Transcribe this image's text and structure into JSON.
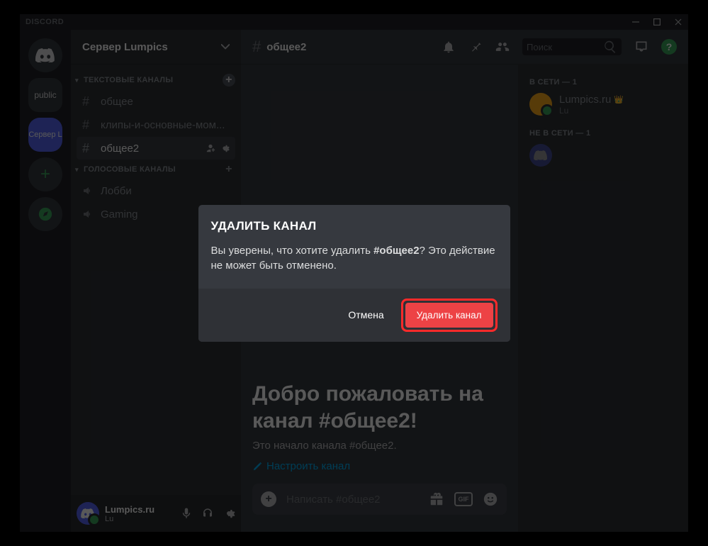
{
  "titlebar": {
    "logo": "DISCORD"
  },
  "server_header": {
    "name": "Сервер Lumpics"
  },
  "categories": {
    "text": {
      "label": "ТЕКСТОВЫЕ КАНАЛЫ"
    },
    "voice": {
      "label": "ГОЛОСОВЫЕ КАНАЛЫ"
    }
  },
  "channels": {
    "text": [
      {
        "name": "общее"
      },
      {
        "name": "клипы-и-основные-мом..."
      },
      {
        "name": "общее2"
      }
    ],
    "voice": [
      {
        "name": "Лобби"
      },
      {
        "name": "Gaming"
      }
    ]
  },
  "chat_header": {
    "title": "общее2",
    "search_placeholder": "Поиск"
  },
  "welcome": {
    "title_l1": "Добро пожаловать на",
    "title_l2": "канал #общее2!",
    "subtitle": "Это начало канала #общее2.",
    "link": "Настроить канал"
  },
  "composer": {
    "placeholder": "Написать #общее2"
  },
  "members": {
    "online_label": "В СЕТИ — 1",
    "offline_label": "НЕ В СЕТИ — 1",
    "online": [
      {
        "name": "Lumpics.ru",
        "tag": "Lu"
      }
    ],
    "offline": [
      {
        "name": ""
      }
    ]
  },
  "user_panel": {
    "name": "Lumpics.ru",
    "tag": "Lu"
  },
  "server_rail": {
    "public": "public",
    "selected": "Сервер L"
  },
  "modal": {
    "title": "УДАЛИТЬ КАНАЛ",
    "text_before": "Вы уверены, что хотите удалить ",
    "text_bold": "#общее2",
    "text_after": "? Это действие не может быть отменено.",
    "cancel": "Отмена",
    "delete": "Удалить канал"
  }
}
